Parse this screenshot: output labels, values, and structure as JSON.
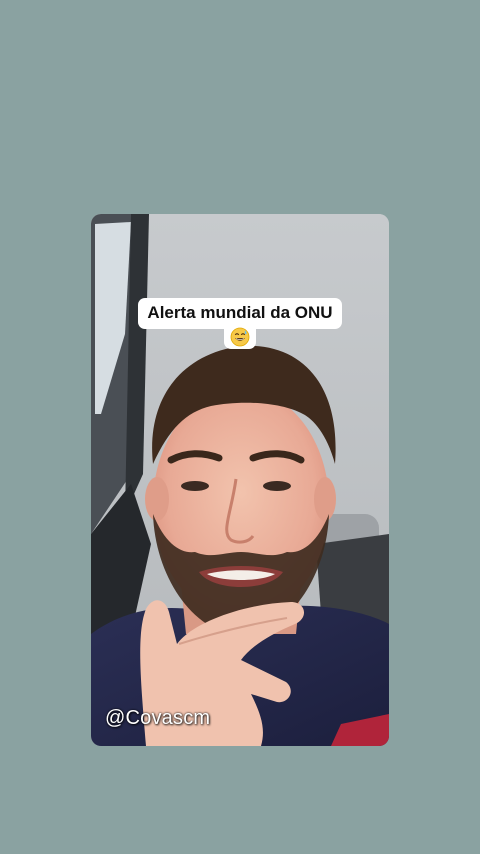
{
  "video": {
    "caption": "Alerta mundial da ONU",
    "caption_emoji": "grinning-sweat-emoji",
    "username": "@Covascm"
  },
  "colors": {
    "page_background": "#8aa2a1",
    "caption_background": "#ffffff",
    "caption_text": "#111111",
    "username_text": "#ffffff"
  }
}
